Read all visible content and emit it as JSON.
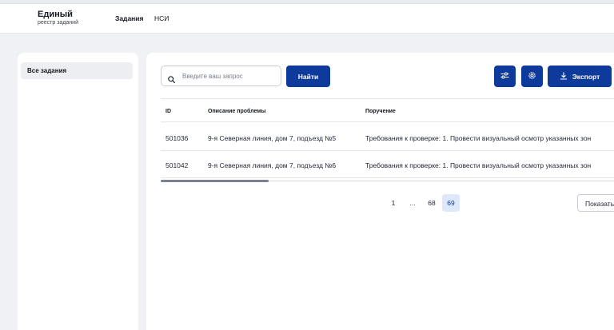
{
  "header": {
    "logo_title": "Единый",
    "logo_subtitle": "реестр заданий",
    "nav": [
      {
        "label": "Задания"
      },
      {
        "label": "НСИ"
      }
    ]
  },
  "sidebar": {
    "items": [
      {
        "label": "Все задания"
      }
    ]
  },
  "toolbar": {
    "search_placeholder": "Введите ваш запрос",
    "search_value": "",
    "find_label": "Найти",
    "export_label": "Экспорт"
  },
  "table": {
    "columns": [
      "ID",
      "Описание проблемы",
      "Поручение"
    ],
    "rows": [
      {
        "id": "501036",
        "description": "9-я Северная линия, дом 7, подъезд №5",
        "task": "Требования к проверке: 1. Провести визуальный осмотр указанных зон"
      },
      {
        "id": "501042",
        "description": "9-я Северная линия, дом 7, подъезд №6",
        "task": "Требования к проверке: 1. Провести визуальный осмотр указанных зон"
      }
    ]
  },
  "pagination": {
    "pages": [
      "1",
      "...",
      "68",
      "69"
    ],
    "current": "69",
    "show_label": "Показать"
  },
  "colors": {
    "primary": "#0d3a9b",
    "active_page_bg": "#dde8fb"
  },
  "icons": [
    "search-icon",
    "filter-icon",
    "gear-icon",
    "download-icon"
  ]
}
